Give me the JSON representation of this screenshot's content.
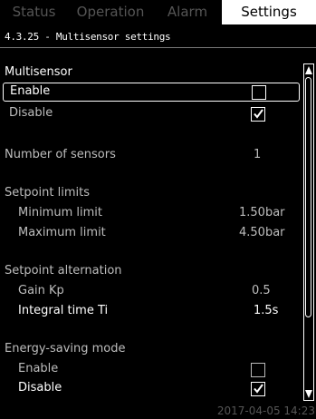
{
  "tabs": [
    {
      "label": "Status",
      "active": false
    },
    {
      "label": "Operation",
      "active": false
    },
    {
      "label": "Alarm",
      "active": false
    },
    {
      "label": "Settings",
      "active": true
    }
  ],
  "breadcrumb": "4.3.25 - Multisensor settings",
  "multisensor": {
    "heading": "Multisensor",
    "enable_label": "Enable",
    "disable_label": "Disable",
    "enable_checked": false,
    "disable_checked": true
  },
  "number_of_sensors": {
    "label": "Number of sensors",
    "value": "1"
  },
  "setpoint_limits": {
    "heading": "Setpoint limits",
    "min_label": "Minimum limit",
    "min_value": "1.50bar",
    "max_label": "Maximum limit",
    "max_value": "4.50bar"
  },
  "setpoint_alternation": {
    "heading": "Setpoint alternation",
    "gain_label": "Gain Kp",
    "gain_value": "0.5",
    "integral_label": "Integral time Ti",
    "integral_value": "1.5s"
  },
  "energy_saving": {
    "heading": "Energy-saving mode",
    "enable_label": "Enable",
    "disable_label": "Disable",
    "enable_checked": false,
    "disable_checked": true
  },
  "datetime": "2017-04-05 14:23",
  "colors": {
    "background": "#000000",
    "text": "#ffffff",
    "dim_text": "#bdbdbd",
    "inactive_tab": "#555555"
  }
}
